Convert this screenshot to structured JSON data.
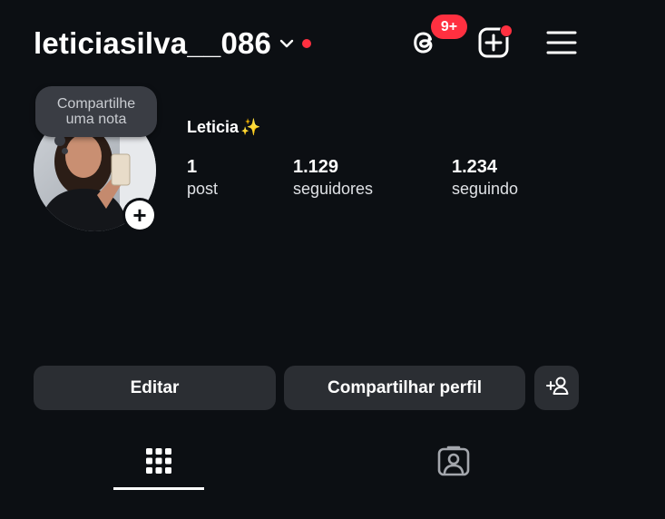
{
  "header": {
    "username": "leticiasilva__086",
    "threads_badge": "9+"
  },
  "note": {
    "line1": "Compartilhe",
    "line2": "uma nota"
  },
  "profile": {
    "display_name": "Leticia",
    "sparkle": "✨",
    "add_story_symbol": "+"
  },
  "stats": {
    "posts": {
      "count": "1",
      "label": "post"
    },
    "followers": {
      "count": "1.129",
      "label": "seguidores"
    },
    "following": {
      "count": "1.234",
      "label": "seguindo"
    }
  },
  "actions": {
    "edit_label": "Editar",
    "share_label": "Compartilhar perfil"
  },
  "tabs": [
    {
      "icon": "grid-icon",
      "active": true
    },
    {
      "icon": "tagged-icon",
      "active": false
    }
  ],
  "colors": {
    "background": "#0c0f13",
    "button": "#2b2e33",
    "badge": "#ff3040",
    "text": "#ffffff"
  }
}
